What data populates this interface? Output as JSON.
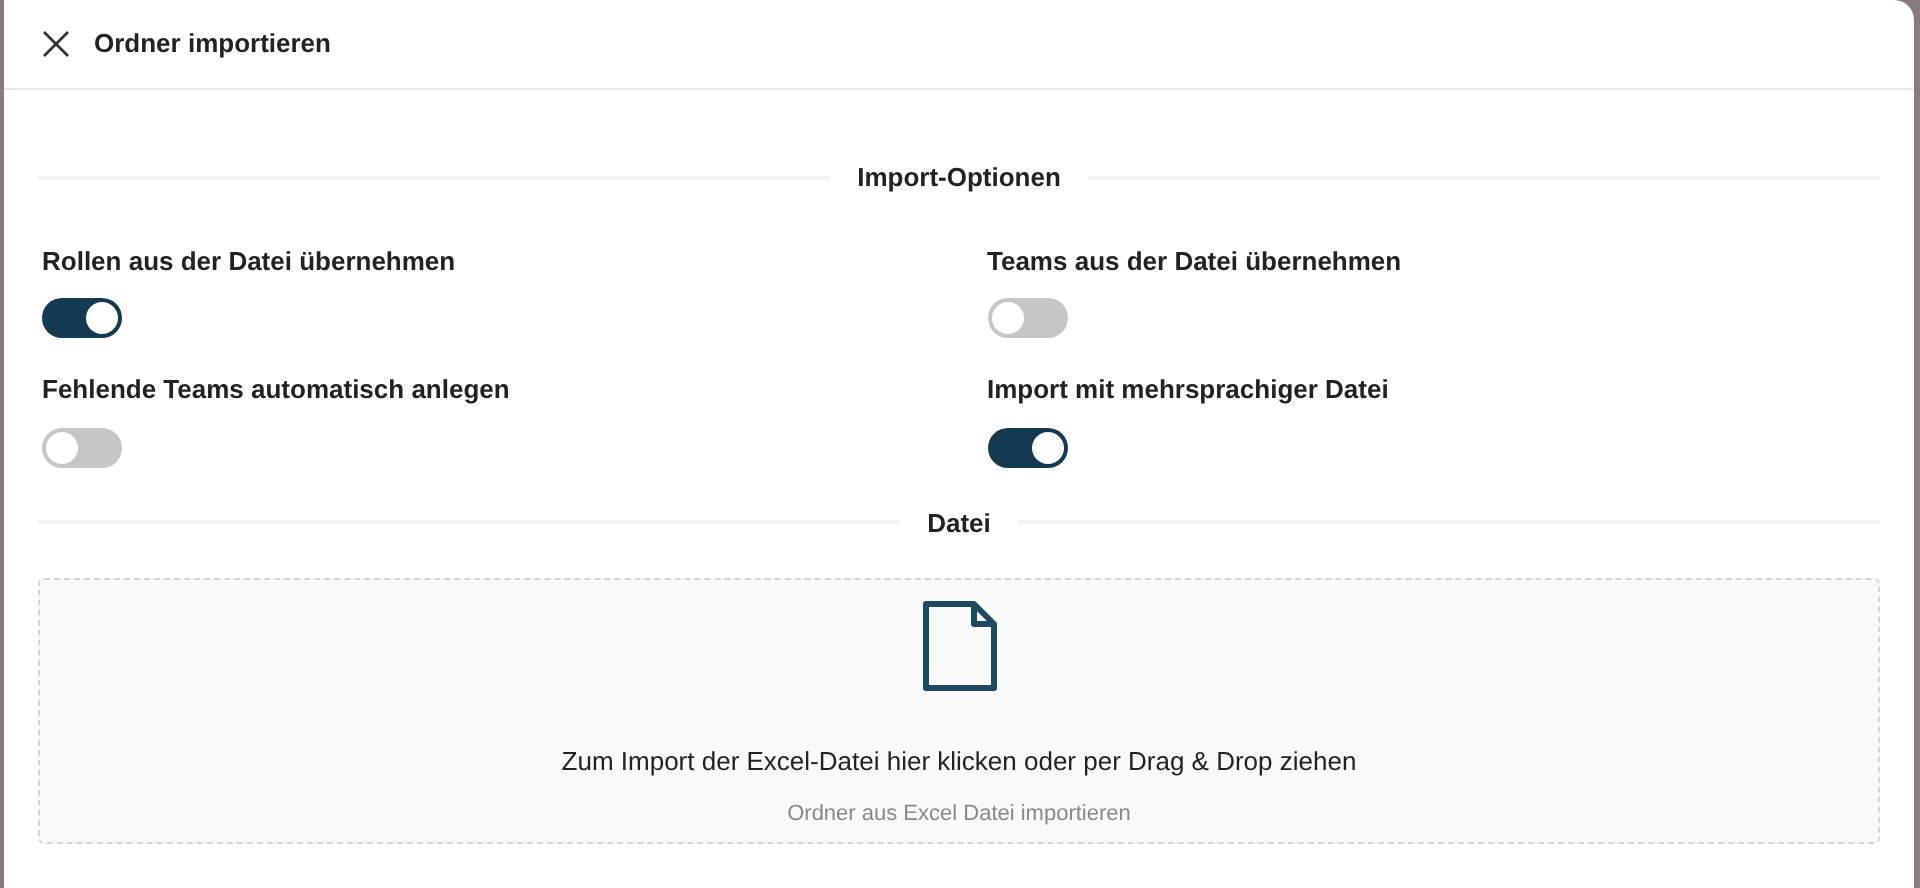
{
  "dialog": {
    "title": "Ordner importieren"
  },
  "sections": [
    {
      "heading": "Import-Optionen"
    },
    {
      "heading": "Datei"
    }
  ],
  "options": [
    {
      "label": "Rollen aus der Datei übernehmen",
      "on": true
    },
    {
      "label": "Teams aus der Datei übernehmen",
      "on": false
    },
    {
      "label": "Fehlende Teams automatisch anlegen",
      "on": false
    },
    {
      "label": "Import mit mehrsprachiger Datei",
      "on": true
    }
  ],
  "dropzone": {
    "text": "Zum Import der Excel-Datei hier klicken oder per Drag & Drop ziehen",
    "hint": "Ordner aus Excel Datei importieren"
  }
}
